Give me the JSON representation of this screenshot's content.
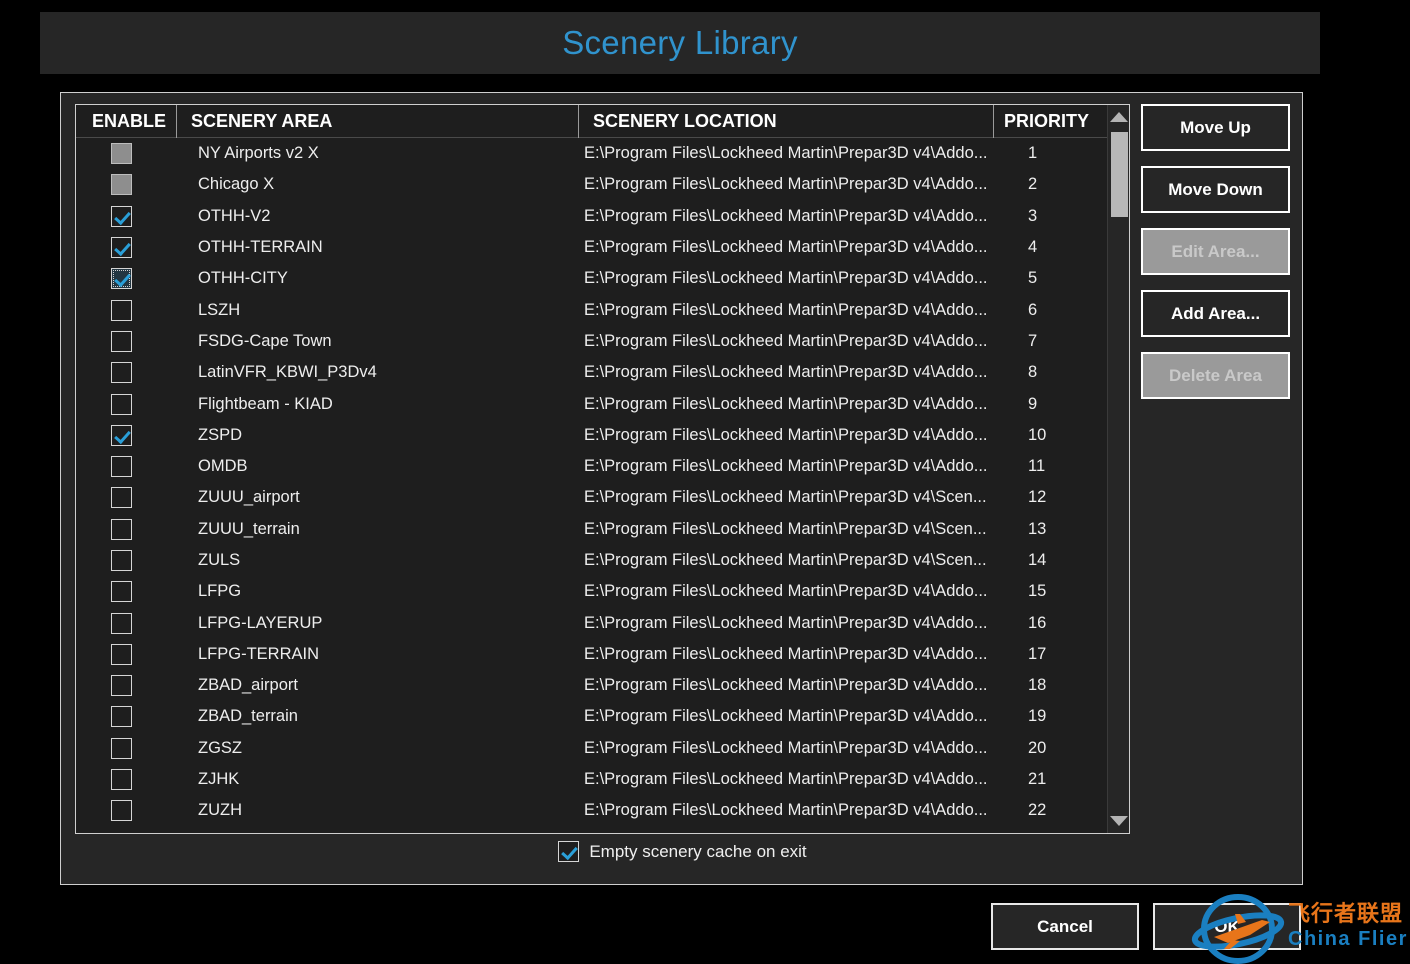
{
  "window": {
    "title": "Scenery Library"
  },
  "table": {
    "columns": [
      {
        "key": "enable",
        "label": "ENABLE"
      },
      {
        "key": "area",
        "label": "SCENERY AREA"
      },
      {
        "key": "location",
        "label": "SCENERY LOCATION"
      },
      {
        "key": "priority",
        "label": "PRIORITY"
      }
    ],
    "rows": [
      {
        "enabled": false,
        "state": "disabled",
        "focused": false,
        "area": "NY Airports v2 X",
        "location": "E:\\Program Files\\Lockheed Martin\\Prepar3D v4\\Addo...",
        "priority": "1"
      },
      {
        "enabled": false,
        "state": "disabled",
        "focused": false,
        "area": "Chicago X",
        "location": "E:\\Program Files\\Lockheed Martin\\Prepar3D v4\\Addo...",
        "priority": "2"
      },
      {
        "enabled": true,
        "state": "checked",
        "focused": false,
        "area": "OTHH-V2",
        "location": "E:\\Program Files\\Lockheed Martin\\Prepar3D v4\\Addo...",
        "priority": "3"
      },
      {
        "enabled": true,
        "state": "checked",
        "focused": false,
        "area": "OTHH-TERRAIN",
        "location": "E:\\Program Files\\Lockheed Martin\\Prepar3D v4\\Addo...",
        "priority": "4"
      },
      {
        "enabled": true,
        "state": "checked",
        "focused": true,
        "area": "OTHH-CITY",
        "location": "E:\\Program Files\\Lockheed Martin\\Prepar3D v4\\Addo...",
        "priority": "5"
      },
      {
        "enabled": false,
        "state": "unchecked",
        "focused": false,
        "area": "LSZH",
        "location": "E:\\Program Files\\Lockheed Martin\\Prepar3D v4\\Addo...",
        "priority": "6"
      },
      {
        "enabled": false,
        "state": "unchecked",
        "focused": false,
        "area": "FSDG-Cape Town",
        "location": "E:\\Program Files\\Lockheed Martin\\Prepar3D v4\\Addo...",
        "priority": "7"
      },
      {
        "enabled": false,
        "state": "unchecked",
        "focused": false,
        "area": "LatinVFR_KBWI_P3Dv4",
        "location": "E:\\Program Files\\Lockheed Martin\\Prepar3D v4\\Addo...",
        "priority": "8"
      },
      {
        "enabled": false,
        "state": "unchecked",
        "focused": false,
        "area": "Flightbeam - KIAD",
        "location": "E:\\Program Files\\Lockheed Martin\\Prepar3D v4\\Addo...",
        "priority": "9"
      },
      {
        "enabled": true,
        "state": "checked",
        "focused": false,
        "area": "ZSPD",
        "location": "E:\\Program Files\\Lockheed Martin\\Prepar3D v4\\Addo...",
        "priority": "10"
      },
      {
        "enabled": false,
        "state": "unchecked",
        "focused": false,
        "area": "OMDB",
        "location": "E:\\Program Files\\Lockheed Martin\\Prepar3D v4\\Addo...",
        "priority": "11"
      },
      {
        "enabled": false,
        "state": "unchecked",
        "focused": false,
        "area": "ZUUU_airport",
        "location": "E:\\Program Files\\Lockheed Martin\\Prepar3D v4\\Scen...",
        "priority": "12"
      },
      {
        "enabled": false,
        "state": "unchecked",
        "focused": false,
        "area": "ZUUU_terrain",
        "location": "E:\\Program Files\\Lockheed Martin\\Prepar3D v4\\Scen...",
        "priority": "13"
      },
      {
        "enabled": false,
        "state": "unchecked",
        "focused": false,
        "area": "ZULS",
        "location": "E:\\Program Files\\Lockheed Martin\\Prepar3D v4\\Scen...",
        "priority": "14"
      },
      {
        "enabled": false,
        "state": "unchecked",
        "focused": false,
        "area": "LFPG",
        "location": "E:\\Program Files\\Lockheed Martin\\Prepar3D v4\\Addo...",
        "priority": "15"
      },
      {
        "enabled": false,
        "state": "unchecked",
        "focused": false,
        "area": "LFPG-LAYERUP",
        "location": "E:\\Program Files\\Lockheed Martin\\Prepar3D v4\\Addo...",
        "priority": "16"
      },
      {
        "enabled": false,
        "state": "unchecked",
        "focused": false,
        "area": "LFPG-TERRAIN",
        "location": "E:\\Program Files\\Lockheed Martin\\Prepar3D v4\\Addo...",
        "priority": "17"
      },
      {
        "enabled": false,
        "state": "unchecked",
        "focused": false,
        "area": "ZBAD_airport",
        "location": "E:\\Program Files\\Lockheed Martin\\Prepar3D v4\\Addo...",
        "priority": "18"
      },
      {
        "enabled": false,
        "state": "unchecked",
        "focused": false,
        "area": "ZBAD_terrain",
        "location": "E:\\Program Files\\Lockheed Martin\\Prepar3D v4\\Addo...",
        "priority": "19"
      },
      {
        "enabled": false,
        "state": "unchecked",
        "focused": false,
        "area": "ZGSZ",
        "location": "E:\\Program Files\\Lockheed Martin\\Prepar3D v4\\Addo...",
        "priority": "20"
      },
      {
        "enabled": false,
        "state": "unchecked",
        "focused": false,
        "area": "ZJHK",
        "location": "E:\\Program Files\\Lockheed Martin\\Prepar3D v4\\Addo...",
        "priority": "21"
      },
      {
        "enabled": false,
        "state": "unchecked",
        "focused": false,
        "area": "ZUZH",
        "location": "E:\\Program Files\\Lockheed Martin\\Prepar3D v4\\Addo...",
        "priority": "22"
      }
    ]
  },
  "side_buttons": [
    {
      "label": "Move Up",
      "enabled": true
    },
    {
      "label": "Move Down",
      "enabled": true
    },
    {
      "label": "Edit Area...",
      "enabled": false
    },
    {
      "label": "Add Area...",
      "enabled": true
    },
    {
      "label": "Delete Area",
      "enabled": false
    }
  ],
  "footer": {
    "empty_cache_label": "Empty scenery cache on exit",
    "empty_cache_checked": true
  },
  "actions": {
    "cancel_label": "Cancel",
    "ok_label": "OK"
  },
  "watermark": {
    "cn_text": "飞行者联盟",
    "en_text": "China Flier"
  },
  "colors": {
    "title_blue": "#3093cd",
    "check_blue": "#2a9fd8",
    "panel_bg": "#262626",
    "list_bg": "#1e1e1e",
    "border": "#cfcfcf",
    "watermark_orange": "#e8751a",
    "watermark_blue": "#1a7fc1"
  }
}
